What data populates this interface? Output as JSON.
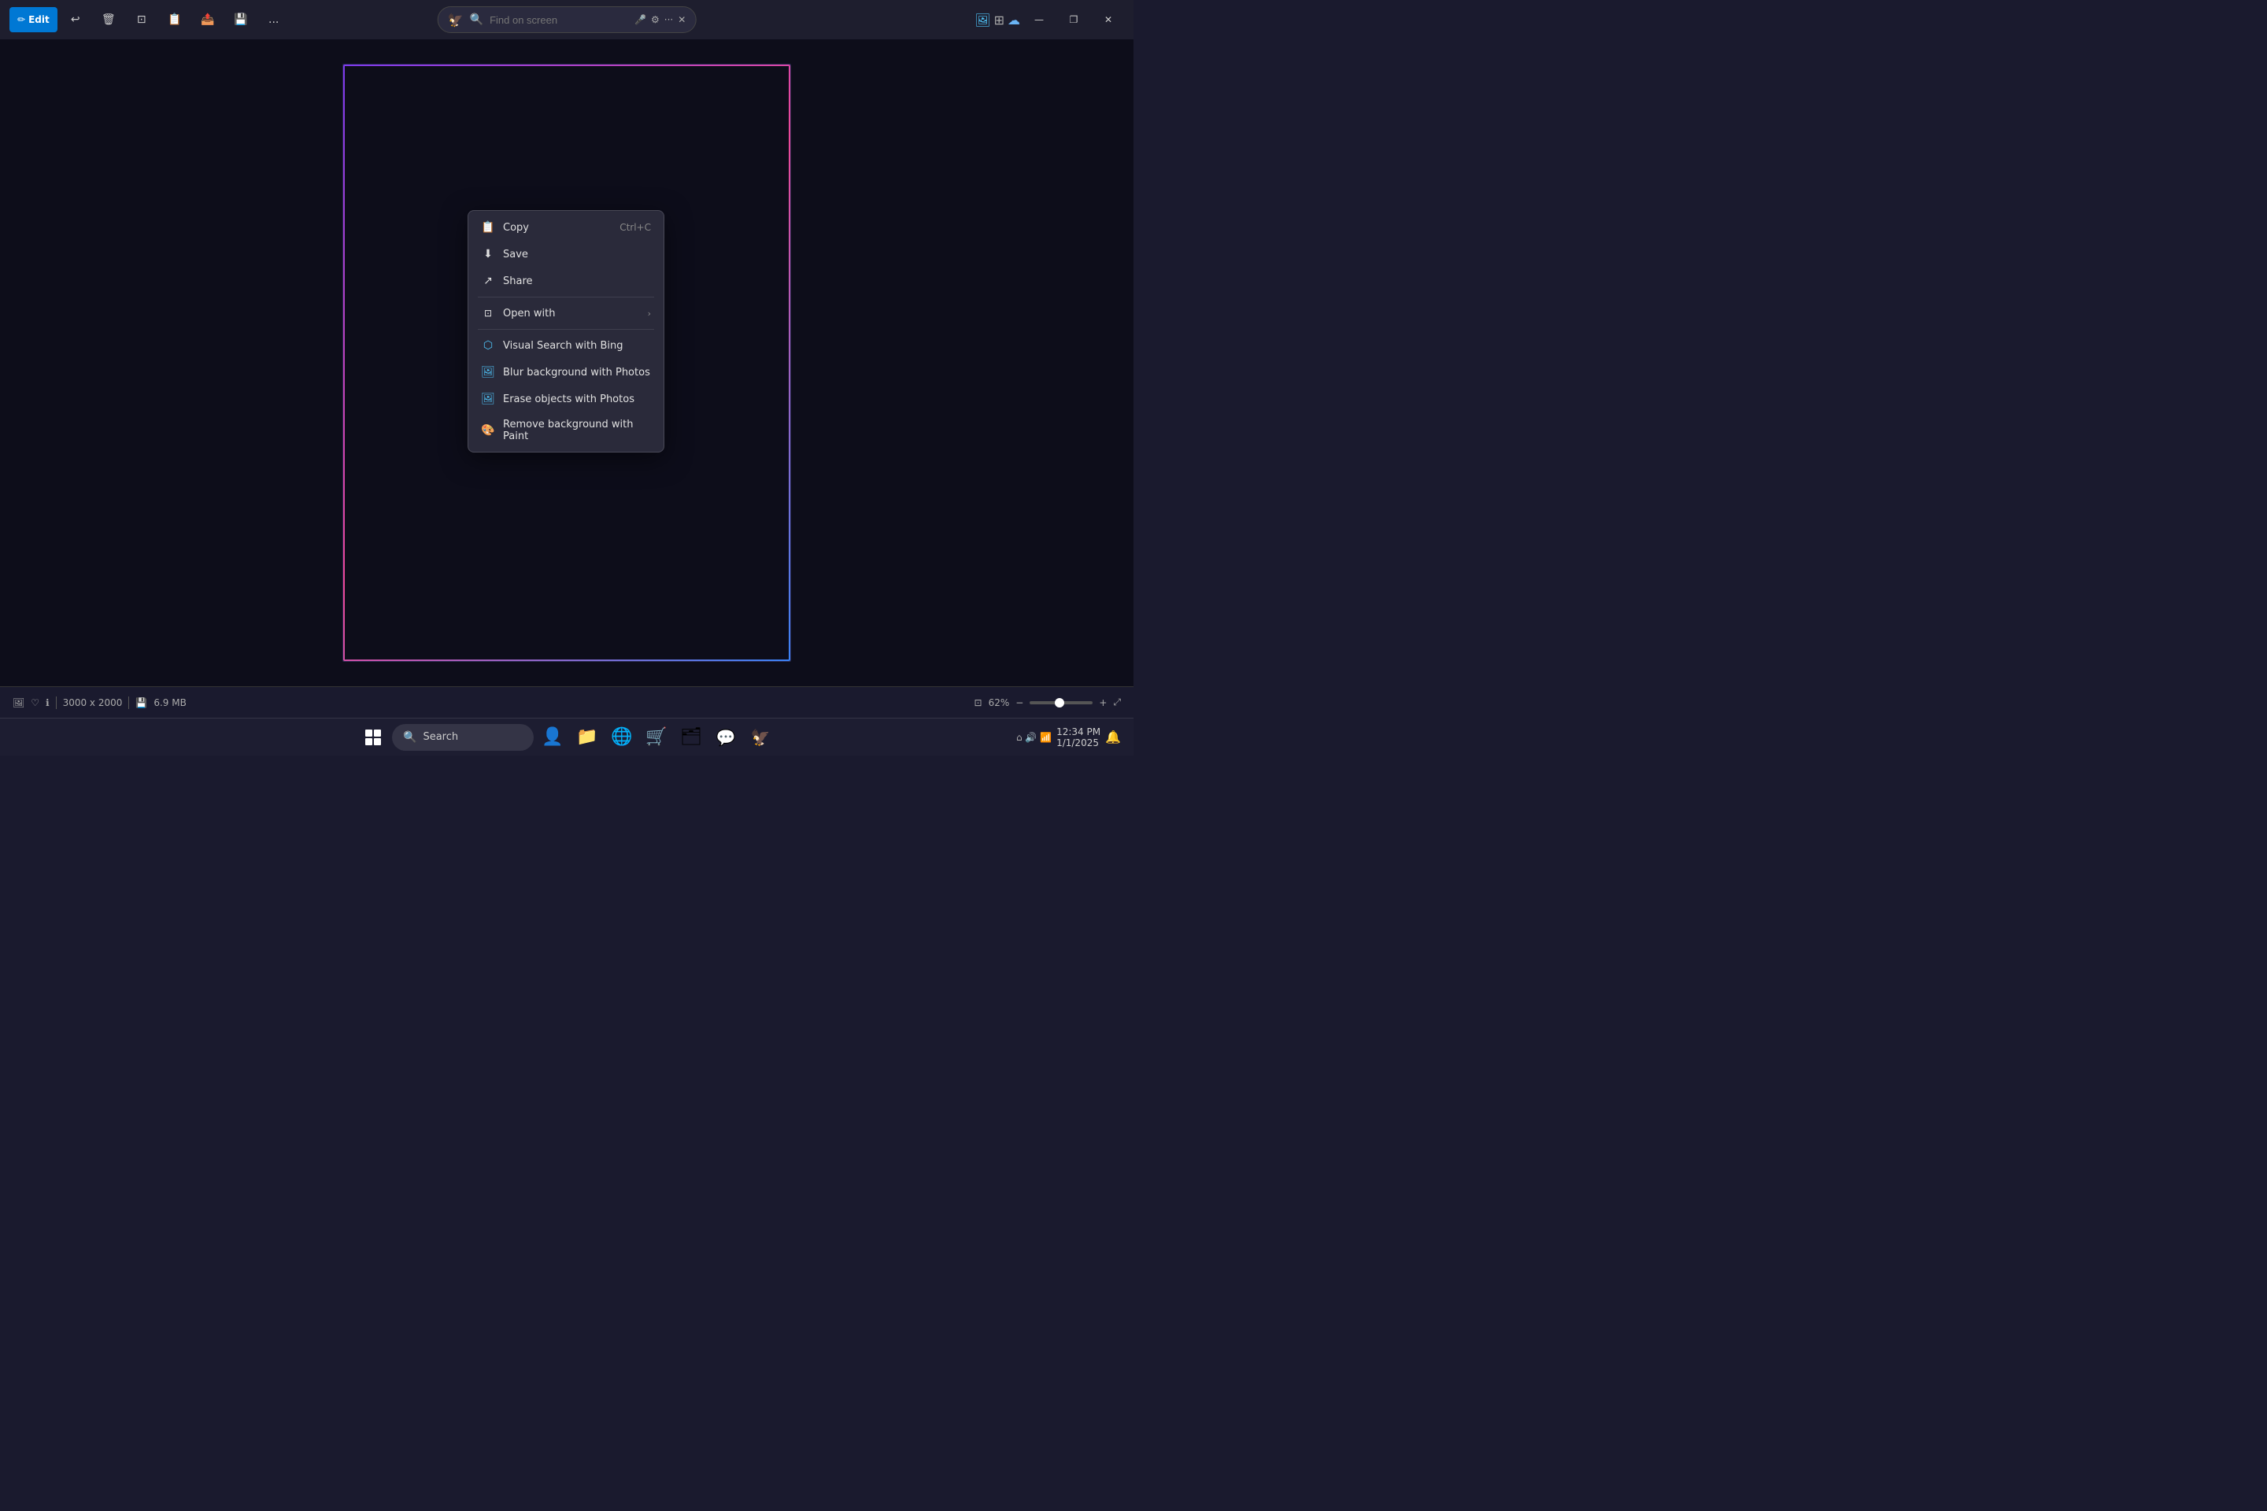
{
  "titlebar": {
    "edit_label": "Edit",
    "address_placeholder": "Find on screen",
    "more_label": "...",
    "minimize": "—",
    "restore": "❐",
    "close": "✕"
  },
  "toolbar_icons": [
    "↩",
    "🗑",
    "✂",
    "📋",
    "📤",
    "💾"
  ],
  "context_menu": {
    "items": [
      {
        "icon": "📋",
        "label": "Copy",
        "shortcut": "Ctrl+C",
        "arrow": ""
      },
      {
        "icon": "💾",
        "label": "Save",
        "shortcut": "",
        "arrow": ""
      },
      {
        "icon": "↗",
        "label": "Share",
        "shortcut": "",
        "arrow": ""
      },
      {
        "icon": "🔗",
        "label": "Open with",
        "shortcut": "",
        "arrow": "›"
      },
      {
        "icon": "🔍",
        "label": "Visual Search with Bing",
        "shortcut": "",
        "arrow": ""
      },
      {
        "icon": "🖼",
        "label": "Blur background with Photos",
        "shortcut": "",
        "arrow": ""
      },
      {
        "icon": "🖼",
        "label": "Erase objects with Photos",
        "shortcut": "",
        "arrow": ""
      },
      {
        "icon": "🎨",
        "label": "Remove background with Paint",
        "shortcut": "",
        "arrow": ""
      }
    ]
  },
  "status_bar": {
    "dimensions": "3000 x 2000",
    "file_size": "6.9 MB",
    "zoom_level": "62%"
  },
  "taskbar": {
    "search_placeholder": "Search",
    "icons": [
      "⊞",
      "🔍",
      "👤",
      "🗂",
      "🌐",
      "🛒",
      "🗃",
      "🔵",
      "🦅"
    ]
  }
}
